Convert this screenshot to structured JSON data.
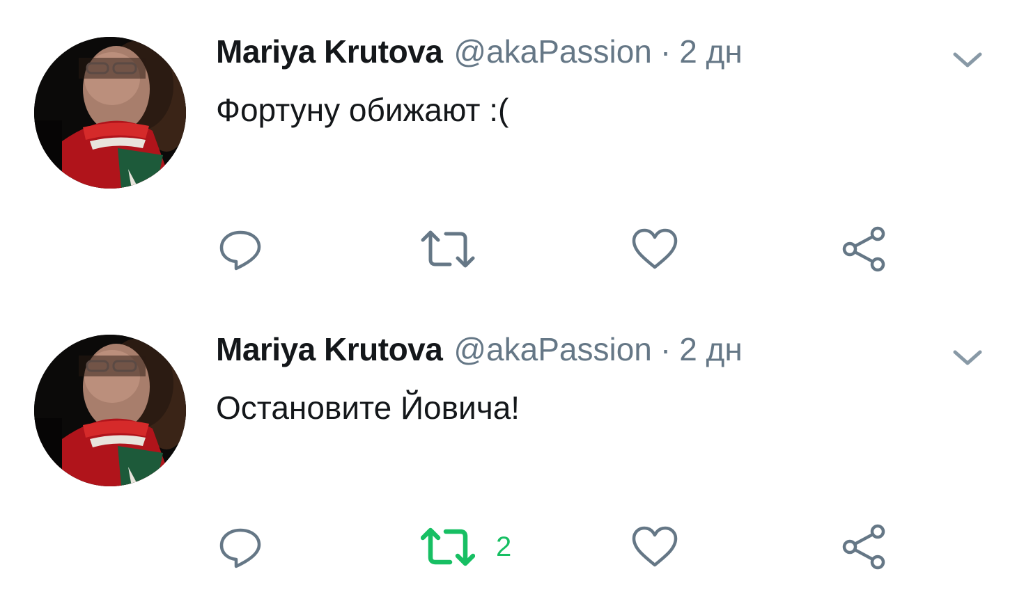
{
  "colors": {
    "name": "#14171a",
    "secondary": "#657786",
    "retweet_active": "#17bf63"
  },
  "tweets": [
    {
      "author_name": "Mariya Krutova",
      "author_handle": "@akaPassion",
      "separator": "·",
      "timestamp": "2 дн",
      "text": "Фортуну обижают :(",
      "retweet_count": "",
      "retweeted": false,
      "icons": [
        "reply-icon",
        "retweet-icon",
        "like-icon",
        "share-icon",
        "chevron-down-icon"
      ]
    },
    {
      "author_name": "Mariya Krutova",
      "author_handle": "@akaPassion",
      "separator": "·",
      "timestamp": "2 дн",
      "text": "Остановите Йовича!",
      "retweet_count": "2",
      "retweeted": true,
      "icons": [
        "reply-icon",
        "retweet-icon",
        "like-icon",
        "share-icon",
        "chevron-down-icon"
      ]
    }
  ]
}
